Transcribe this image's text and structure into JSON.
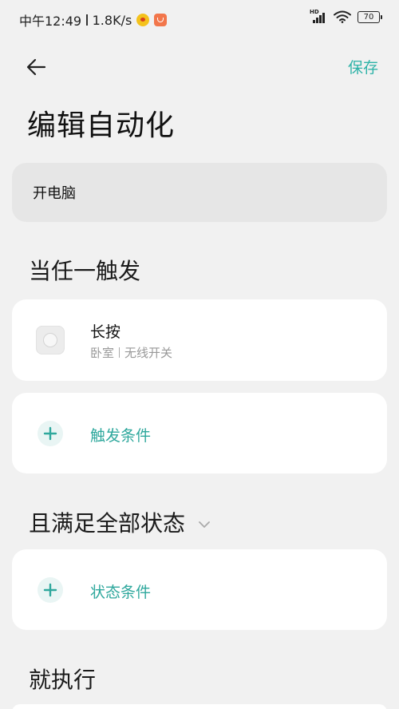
{
  "status_bar": {
    "time": "中午12:49",
    "speed": "1.8K/s",
    "signal_label": "HD",
    "battery": "70",
    "icons": [
      "weibo-icon",
      "app-notification-icon",
      "signal-icon",
      "wifi-icon",
      "battery-icon"
    ]
  },
  "header": {
    "back_icon": "arrow-left-icon",
    "save_label": "保存",
    "title": "编辑自动化"
  },
  "automation_name": "开电脑",
  "trigger_section": {
    "title": "当任一触发",
    "items": [
      {
        "title": "长按",
        "room": "卧室",
        "device": "无线开关",
        "icon": "wireless-switch-icon"
      }
    ],
    "add_label": "触发条件"
  },
  "condition_section": {
    "title": "且满足全部状态",
    "add_label": "状态条件"
  },
  "action_section": {
    "title": "就执行"
  },
  "colors": {
    "accent": "#2fb3a8",
    "background": "#f1f1f1",
    "card": "#ffffff",
    "name_field": "#e6e6e6"
  }
}
